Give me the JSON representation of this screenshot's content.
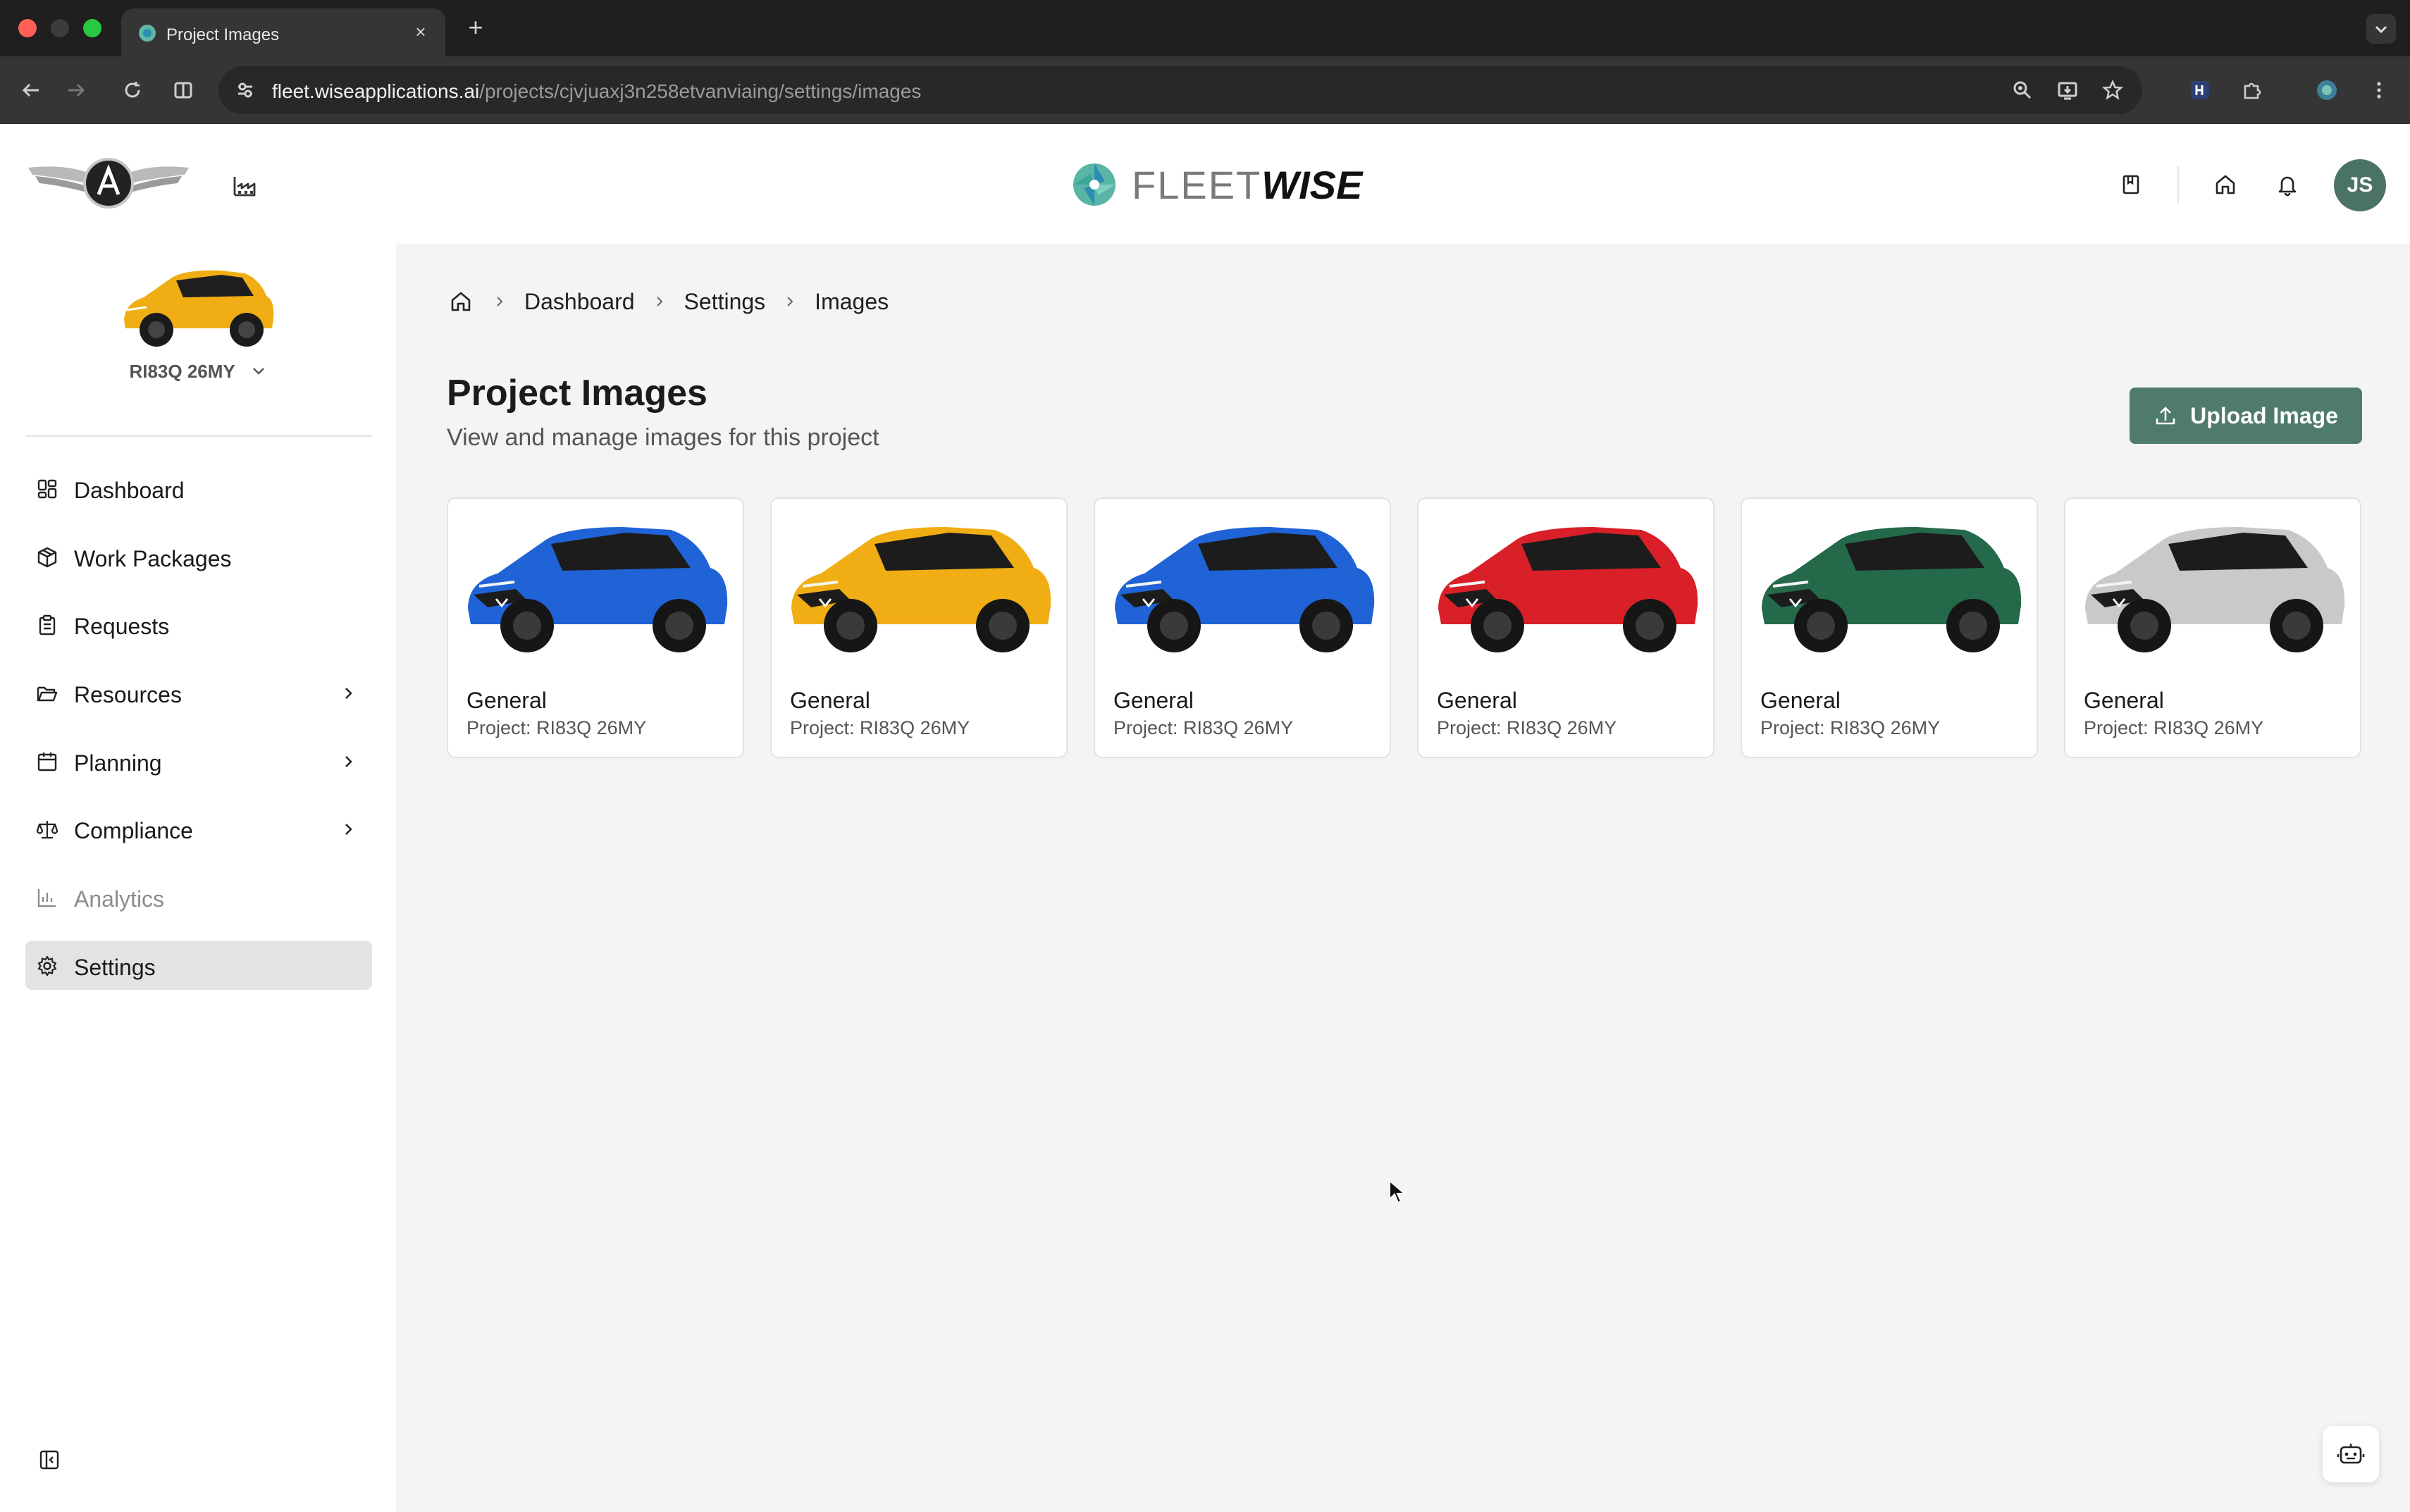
{
  "browser": {
    "tab_title": "Project Images",
    "url_host": "fleet.wiseapplications.ai",
    "url_path": "/projects/cjvjuaxj3n258etvanviaing/settings/images"
  },
  "header": {
    "logo_text_light": "FLEET",
    "logo_text_bold": "WISE",
    "user_initials": "JS"
  },
  "sidebar": {
    "project_name": "RI83Q 26MY",
    "items": [
      {
        "label": "Dashboard"
      },
      {
        "label": "Work Packages"
      },
      {
        "label": "Requests"
      },
      {
        "label": "Resources"
      },
      {
        "label": "Planning"
      },
      {
        "label": "Compliance"
      },
      {
        "label": "Analytics"
      },
      {
        "label": "Settings"
      }
    ]
  },
  "breadcrumb": [
    "Dashboard",
    "Settings",
    "Images"
  ],
  "page": {
    "title": "Project Images",
    "subtitle": "View and manage images for this project",
    "upload_label": "Upload Image"
  },
  "images": [
    {
      "title": "General",
      "project": "Project: RI83Q 26MY",
      "color": "#1f63d6"
    },
    {
      "title": "General",
      "project": "Project: RI83Q 26MY",
      "color": "#f0ad14"
    },
    {
      "title": "General",
      "project": "Project: RI83Q 26MY",
      "color": "#1f63d6"
    },
    {
      "title": "General",
      "project": "Project: RI83Q 26MY",
      "color": "#d92028"
    },
    {
      "title": "General",
      "project": "Project: RI83Q 26MY",
      "color": "#24694a"
    },
    {
      "title": "General",
      "project": "Project: RI83Q 26MY",
      "color": "#c9c9c9"
    }
  ],
  "colors": {
    "accent": "#4e7b6d",
    "active_nav": "#e3e3e3"
  }
}
